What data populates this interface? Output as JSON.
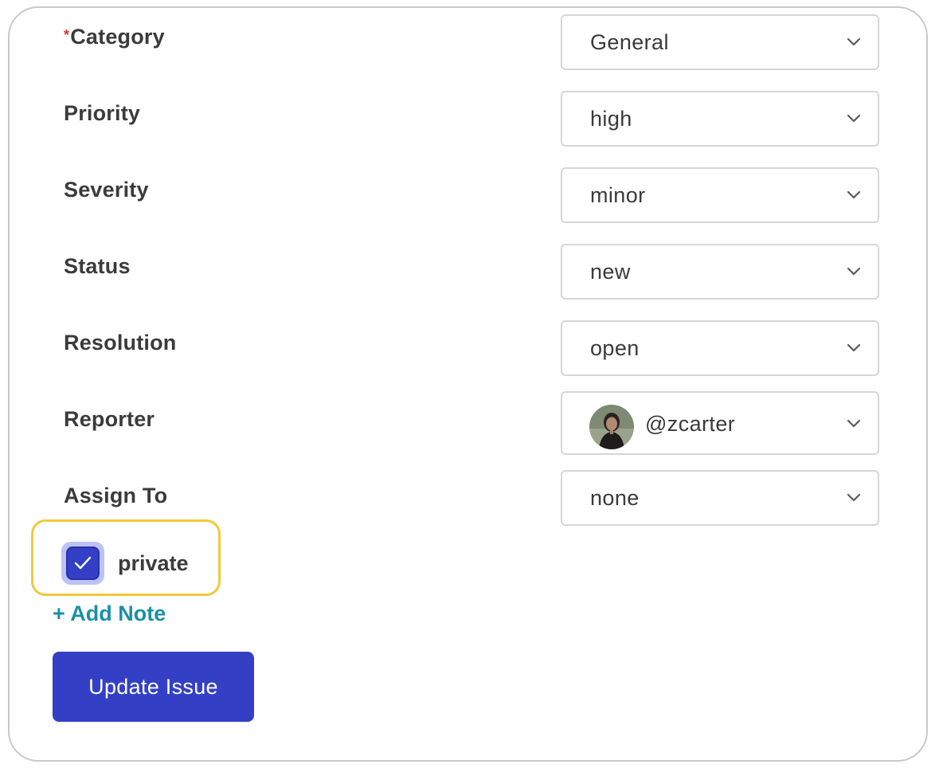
{
  "form": {
    "fields": [
      {
        "label": "Category",
        "required": true,
        "value": "General"
      },
      {
        "label": "Priority",
        "value": "high"
      },
      {
        "label": "Severity",
        "value": "minor"
      },
      {
        "label": "Status",
        "value": "new"
      },
      {
        "label": "Resolution",
        "value": "open"
      },
      {
        "label": "Reporter",
        "value": "@zcarter",
        "has_avatar": true
      },
      {
        "label": "Assign To",
        "value": "none"
      }
    ],
    "required_marker": "*",
    "private": {
      "label": "private",
      "checked": true
    },
    "add_note_label": "+ Add Note",
    "submit_label": "Update Issue"
  },
  "icons": {
    "dropdown": "chevron-down-icon",
    "checkbox": "checkmark-icon",
    "avatar": "user-avatar"
  },
  "colors": {
    "primary": "#3340c6",
    "link": "#1b8fa7",
    "required": "#e0342a",
    "highlight_border": "#f1c93b",
    "checkbox_ring": "#bcc1f6"
  }
}
